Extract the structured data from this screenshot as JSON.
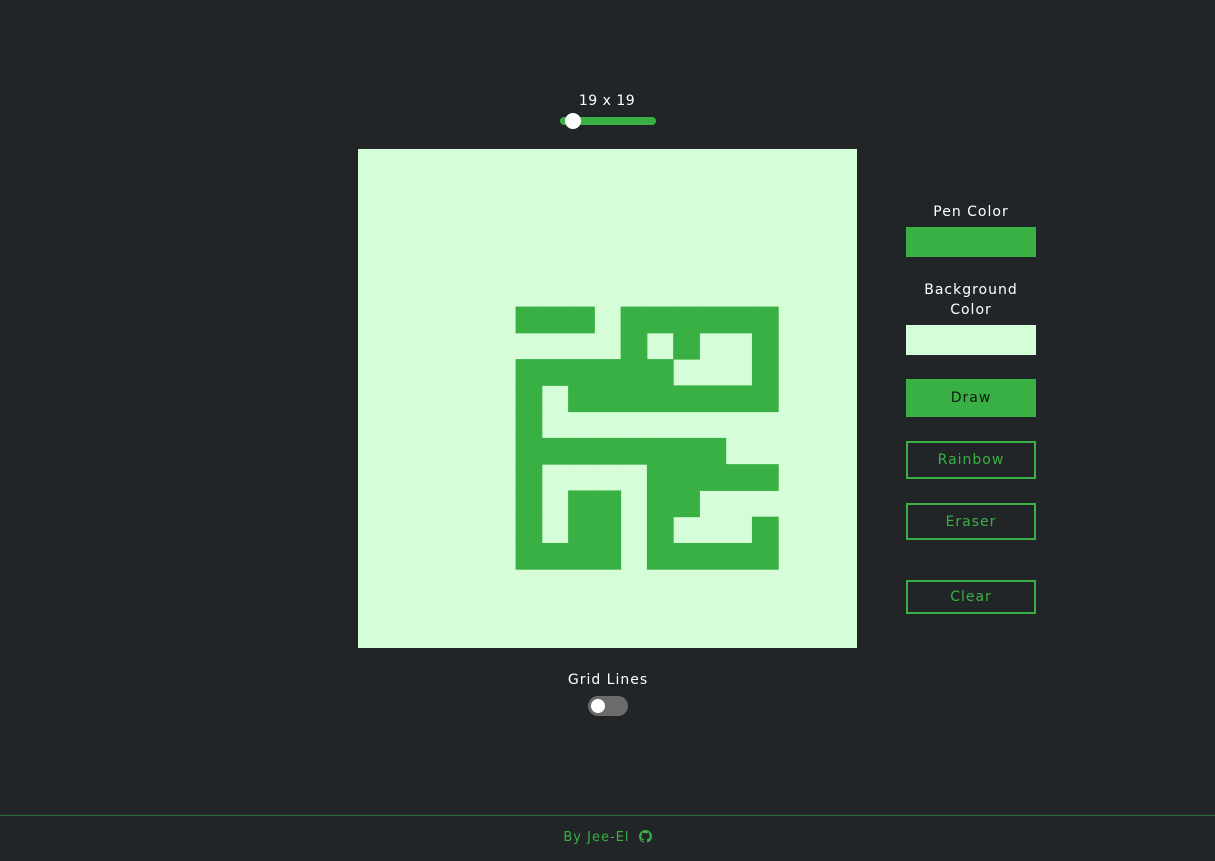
{
  "grid": {
    "size_label": "19 x 19",
    "size": 19,
    "size_min": 16,
    "size_max": 64,
    "pixels": [
      "...................",
      "...................",
      "...................",
      "...................",
      "...................",
      "...................",
      "......###.######...",
      "..........#.#..#...",
      "......######...#...",
      "......#.########...",
      "......#............",
      "......########.....",
      "......#....#####...",
      "......#.##.##......",
      "......#.##.#...#...",
      "......####.#####...",
      "...................",
      "...................",
      "..................."
    ]
  },
  "colors": {
    "pen": "#38b043",
    "background": "#d5fdd8",
    "page": "#222528"
  },
  "panel": {
    "pen_color_label": "Pen Color",
    "background_color_label": "Background Color",
    "draw_label": "Draw",
    "rainbow_label": "Rainbow",
    "eraser_label": "Eraser",
    "clear_label": "Clear",
    "active_mode": "Draw"
  },
  "grid_lines": {
    "label": "Grid Lines",
    "enabled": false
  },
  "footer": {
    "text": "By Jee-El",
    "icon": "github-icon"
  }
}
